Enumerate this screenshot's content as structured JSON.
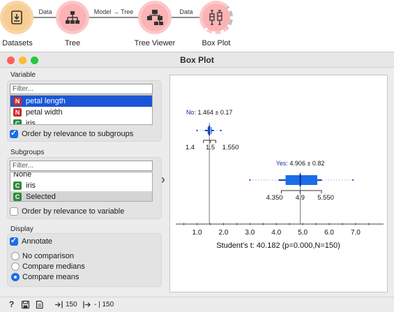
{
  "workflow": {
    "nodes": [
      {
        "label": "Datasets",
        "icon": "datasets-icon",
        "color": "#f6c98a",
        "ring": "#f6c98a"
      },
      {
        "label": "Tree",
        "icon": "tree-icon",
        "color": "#fbb7b8",
        "ring": "#f9a5a6"
      },
      {
        "label": "Tree Viewer",
        "icon": "tree-viewer-icon",
        "color": "#fbb7b8",
        "ring": "#f9a5a6"
      },
      {
        "label": "Box Plot",
        "icon": "box-plot-icon",
        "color": "#fbb7b8",
        "ring": "#f9a5a6"
      }
    ],
    "links": [
      "Data",
      "Model → Tree",
      "Data"
    ]
  },
  "window": {
    "title": "Box Plot",
    "colors": {
      "close": "#ff5f57",
      "minimize": "#febc2e",
      "zoom": "#28c840"
    }
  },
  "variable": {
    "label": "Variable",
    "filter_placeholder": "Filter...",
    "items": [
      {
        "type": "N",
        "name": "petal length",
        "selected": true
      },
      {
        "type": "N",
        "name": "petal width",
        "selected": false
      },
      {
        "type": "C",
        "name": "iris",
        "selected": false
      }
    ],
    "order_by_relevance": {
      "label": "Order by relevance to subgroups",
      "checked": true
    }
  },
  "subgroups": {
    "label": "Subgroups",
    "filter_placeholder": "Filter...",
    "items": [
      {
        "type": "",
        "name": "None"
      },
      {
        "type": "C",
        "name": "iris"
      },
      {
        "type": "C",
        "name": "Selected"
      }
    ],
    "order_by_relevance": {
      "label": "Order by relevance to variable",
      "checked": false
    }
  },
  "display": {
    "label": "Display",
    "annotate": {
      "label": "Annotate",
      "checked": true
    },
    "options": [
      {
        "label": "No comparison",
        "checked": false
      },
      {
        "label": "Compare medians",
        "checked": false
      },
      {
        "label": "Compare means",
        "checked": true
      }
    ]
  },
  "collapse_arrow": "›",
  "chart_data": {
    "type": "box",
    "xlim": [
      0.35,
      7.9
    ],
    "ticks": [
      1.0,
      2.0,
      3.0,
      4.0,
      5.0,
      6.0,
      7.0
    ],
    "tick_labels": [
      "1.0",
      "2.0",
      "3.0",
      "4.0",
      "5.0",
      "6.0",
      "7.0"
    ],
    "groups": [
      {
        "name": "No",
        "min": 1.0,
        "q1": 1.4,
        "median": 1.5,
        "q3": 1.55,
        "max": 1.9,
        "mean": 1.464,
        "sd": 0.17,
        "mean_label": "1.464 ± 0.17",
        "quartile_labels": [
          "1.4",
          "1.5",
          "1.550"
        ],
        "color": "#1a6ee8"
      },
      {
        "name": "Yes",
        "min": 3.0,
        "q1": 4.35,
        "median": 4.9,
        "q3": 5.55,
        "max": 6.9,
        "mean": 4.906,
        "sd": 0.82,
        "mean_label": "4.906 ± 0.82",
        "quartile_labels": [
          "4.350",
          "4.9",
          "5.550"
        ],
        "color": "#1a6ee8"
      }
    ],
    "compare_line": 4.906,
    "compare_line_2": 1.464,
    "statistic": "Student's t: 40.182 (p=0.000,N=150)"
  },
  "statusbar": {
    "help_icon": "?",
    "data_in": "150",
    "data_out": "- | 150"
  }
}
